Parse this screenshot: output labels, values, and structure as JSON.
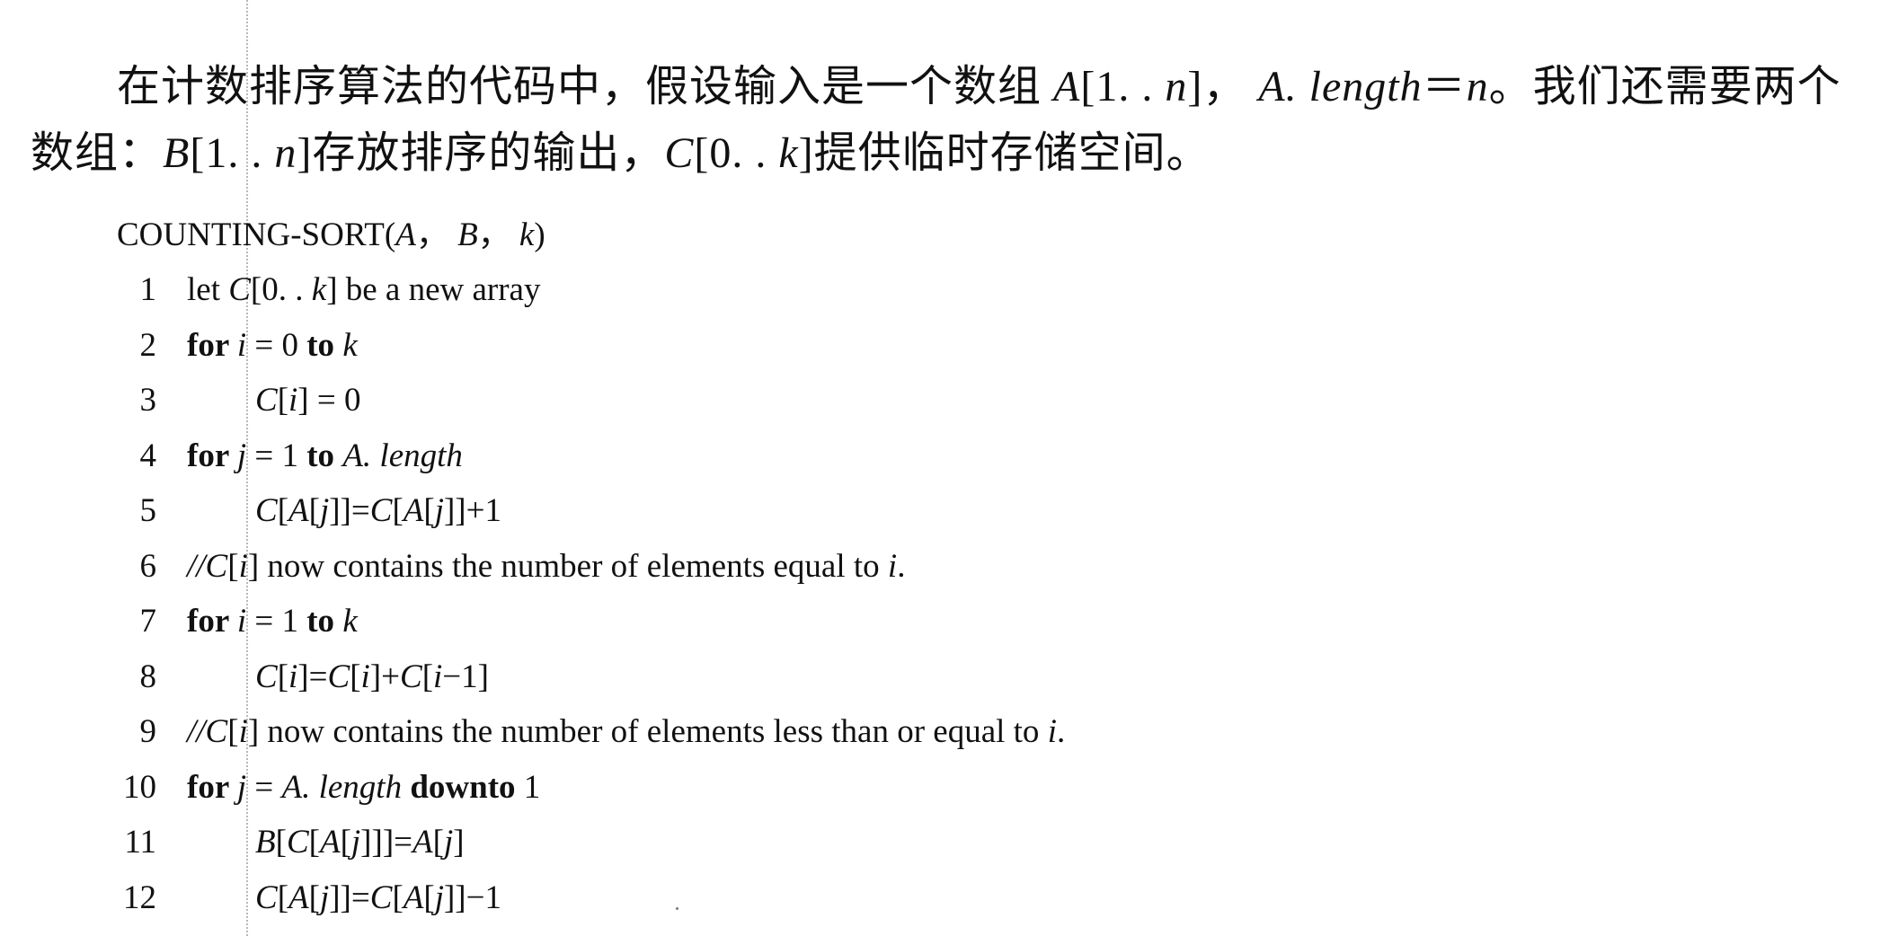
{
  "paragraph": {
    "line1": [
      {
        "t": "在计数排序算法的代码中，假设输入是一个数组 "
      },
      {
        "t": "A",
        "i": true
      },
      {
        "t": "[1. . "
      },
      {
        "t": "n",
        "i": true
      },
      {
        "t": "]， "
      },
      {
        "t": "A. length",
        "i": true
      },
      {
        "t": "＝"
      },
      {
        "t": "n",
        "i": true
      },
      {
        "t": "。我们还需要两个"
      }
    ],
    "line2": [
      {
        "t": "数组："
      },
      {
        "t": "B",
        "i": true
      },
      {
        "t": "[1. . "
      },
      {
        "t": "n",
        "i": true
      },
      {
        "t": "]存放排序的输出，"
      },
      {
        "t": "C",
        "i": true
      },
      {
        "t": "[0. . "
      },
      {
        "t": "k",
        "i": true
      },
      {
        "t": "]提供临时存储空间。"
      }
    ]
  },
  "code": {
    "title": [
      {
        "t": "COUNTING-SORT("
      },
      {
        "t": "A",
        "i": true
      },
      {
        "t": "， "
      },
      {
        "t": "B",
        "i": true
      },
      {
        "t": "， "
      },
      {
        "t": "k",
        "i": true
      },
      {
        "t": ")"
      }
    ],
    "lines": [
      {
        "n": "1",
        "indent": false,
        "parts": [
          {
            "t": "let "
          },
          {
            "t": "C",
            "i": true
          },
          {
            "t": "[0. . "
          },
          {
            "t": "k",
            "i": true
          },
          {
            "t": "] be a new array"
          }
        ]
      },
      {
        "n": "2",
        "indent": false,
        "parts": [
          {
            "t": "for ",
            "b": true
          },
          {
            "t": "i",
            "i": true
          },
          {
            "t": " = 0 "
          },
          {
            "t": "to ",
            "b": true
          },
          {
            "t": "k",
            "i": true
          }
        ]
      },
      {
        "n": "3",
        "indent": true,
        "parts": [
          {
            "t": "C",
            "i": true
          },
          {
            "t": "["
          },
          {
            "t": "i",
            "i": true
          },
          {
            "t": "] = 0"
          }
        ]
      },
      {
        "n": "4",
        "indent": false,
        "parts": [
          {
            "t": "for ",
            "b": true
          },
          {
            "t": "j",
            "i": true
          },
          {
            "t": " = 1 "
          },
          {
            "t": "to ",
            "b": true
          },
          {
            "t": "A. length",
            "i": true
          }
        ]
      },
      {
        "n": "5",
        "indent": true,
        "parts": [
          {
            "t": "C",
            "i": true
          },
          {
            "t": "["
          },
          {
            "t": "A",
            "i": true
          },
          {
            "t": "["
          },
          {
            "t": "j",
            "i": true
          },
          {
            "t": "]]="
          },
          {
            "t": "C",
            "i": true
          },
          {
            "t": "["
          },
          {
            "t": "A",
            "i": true
          },
          {
            "t": "["
          },
          {
            "t": "j",
            "i": true
          },
          {
            "t": "]]+1"
          }
        ]
      },
      {
        "n": "6",
        "indent": false,
        "parts": [
          {
            "t": "//C",
            "i": true
          },
          {
            "t": "["
          },
          {
            "t": "i",
            "i": true
          },
          {
            "t": "] now contains the number of elements equal to "
          },
          {
            "t": "i",
            "i": true
          },
          {
            "t": "."
          }
        ]
      },
      {
        "n": "7",
        "indent": false,
        "parts": [
          {
            "t": "for ",
            "b": true
          },
          {
            "t": "i",
            "i": true
          },
          {
            "t": " = 1 "
          },
          {
            "t": "to ",
            "b": true
          },
          {
            "t": "k",
            "i": true
          }
        ]
      },
      {
        "n": "8",
        "indent": true,
        "parts": [
          {
            "t": "C",
            "i": true
          },
          {
            "t": "["
          },
          {
            "t": "i",
            "i": true
          },
          {
            "t": "]="
          },
          {
            "t": "C",
            "i": true
          },
          {
            "t": "["
          },
          {
            "t": "i",
            "i": true
          },
          {
            "t": "]+"
          },
          {
            "t": "C",
            "i": true
          },
          {
            "t": "["
          },
          {
            "t": "i",
            "i": true
          },
          {
            "t": "−1]"
          }
        ]
      },
      {
        "n": "9",
        "indent": false,
        "parts": [
          {
            "t": "//C",
            "i": true
          },
          {
            "t": "["
          },
          {
            "t": "i",
            "i": true
          },
          {
            "t": "] now contains the number of elements less than or equal to "
          },
          {
            "t": "i",
            "i": true
          },
          {
            "t": "."
          }
        ]
      },
      {
        "n": "10",
        "indent": false,
        "parts": [
          {
            "t": "for ",
            "b": true
          },
          {
            "t": "j",
            "i": true
          },
          {
            "t": " = "
          },
          {
            "t": "A. length",
            "i": true
          },
          {
            "t": " downto",
            "b": true
          },
          {
            "t": " 1"
          }
        ]
      },
      {
        "n": "11",
        "indent": true,
        "parts": [
          {
            "t": "B",
            "i": true
          },
          {
            "t": "["
          },
          {
            "t": "C",
            "i": true
          },
          {
            "t": "["
          },
          {
            "t": "A",
            "i": true
          },
          {
            "t": "["
          },
          {
            "t": "j",
            "i": true
          },
          {
            "t": "]]]="
          },
          {
            "t": "A",
            "i": true
          },
          {
            "t": "["
          },
          {
            "t": "j",
            "i": true
          },
          {
            "t": "]"
          }
        ]
      },
      {
        "n": "12",
        "indent": true,
        "parts": [
          {
            "t": "C",
            "i": true
          },
          {
            "t": "["
          },
          {
            "t": "A",
            "i": true
          },
          {
            "t": "["
          },
          {
            "t": "j",
            "i": true
          },
          {
            "t": "]]="
          },
          {
            "t": "C",
            "i": true
          },
          {
            "t": "["
          },
          {
            "t": "A",
            "i": true
          },
          {
            "t": "["
          },
          {
            "t": "j",
            "i": true
          },
          {
            "t": "]]−1"
          }
        ]
      }
    ]
  }
}
